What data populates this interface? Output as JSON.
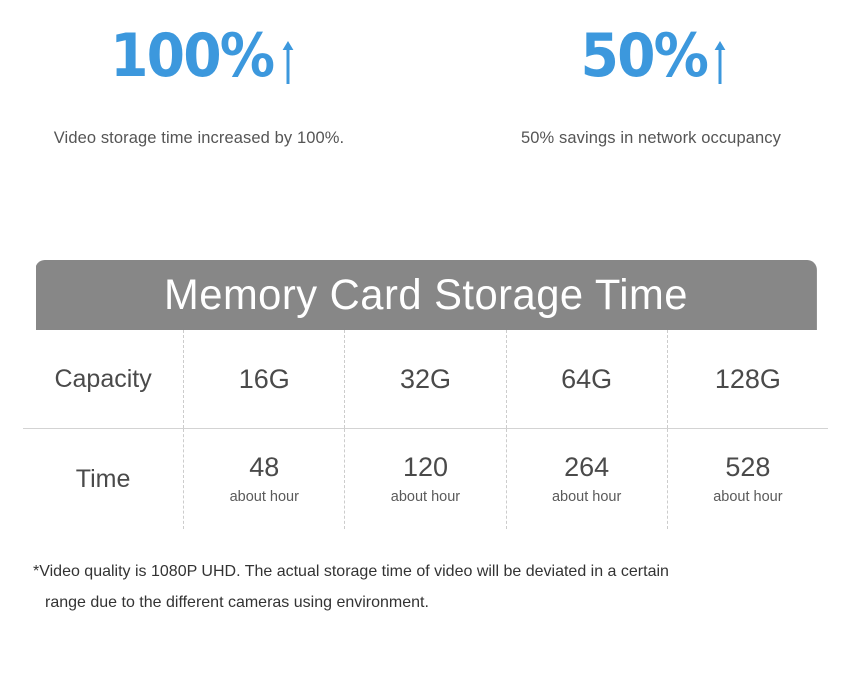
{
  "stats": [
    {
      "value": "100%",
      "arrow_icon": "arrow-up-icon",
      "caption": "Video storage time increased by 100%."
    },
    {
      "value": "50%",
      "arrow_icon": "arrow-up-icon",
      "caption": "50% savings in network occupancy"
    }
  ],
  "table": {
    "title": "Memory Card Storage Time",
    "row_labels": {
      "capacity": "Capacity",
      "time": "Time"
    },
    "capacities": [
      "16G",
      "32G",
      "64G",
      "128G"
    ],
    "times": [
      {
        "value": "48",
        "unit": "about hour"
      },
      {
        "value": "120",
        "unit": "about hour"
      },
      {
        "value": "264",
        "unit": "about hour"
      },
      {
        "value": "528",
        "unit": "about hour"
      }
    ]
  },
  "footnote": {
    "line1": "*Video quality is 1080P UHD. The actual storage time of video will be deviated in a certain",
    "line2": "range due to the different cameras using environment."
  },
  "colors": {
    "accent_blue": "#3c98dd",
    "header_gray": "#878787",
    "text_gray": "#4a4a4a",
    "caption_gray": "#555555",
    "divider_gray": "#cccccc"
  }
}
